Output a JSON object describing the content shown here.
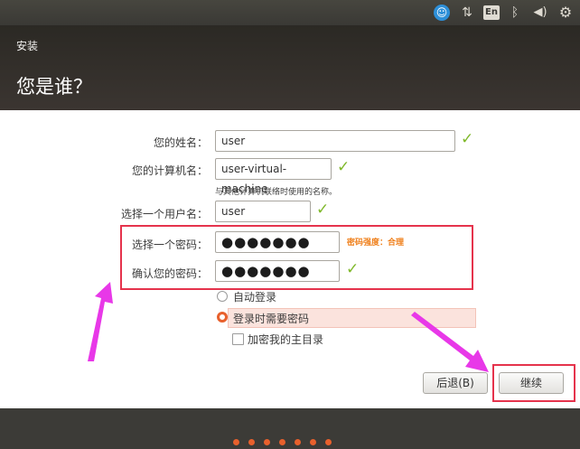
{
  "topbar": {
    "access_icon": "☺",
    "network_icon": "⇅",
    "keyboard_layout": "En",
    "bluetooth_icon": "ᛒ",
    "volume_icon": "◀)",
    "settings_icon": "⚙"
  },
  "header": {
    "title": "安装",
    "heading": "您是谁？"
  },
  "form": {
    "name_label": "您的姓名：",
    "name_value": "user",
    "computer_label": "您的计算机名：",
    "computer_value": "user-virtual-machine",
    "computer_hint": "与其他计算机联络时使用的名称。",
    "username_label": "选择一个用户名：",
    "username_value": "user",
    "password_label": "选择一个密码：",
    "password_value": "●●●●●●●",
    "password_strength": "密码强度：合理",
    "confirm_label": "确认您的密码：",
    "confirm_value": "●●●●●●●",
    "check_mark": "✓"
  },
  "login": {
    "auto_login": "自动登录",
    "require_password": "登录时需要密码",
    "encrypt_home": "加密我的主目录"
  },
  "buttons": {
    "back": "后退(B)",
    "continue": "继续"
  },
  "colors": {
    "accent": "#e8602c",
    "annotation": "#e5334c",
    "arrow": "#e838e8",
    "check": "#7fb82a"
  }
}
